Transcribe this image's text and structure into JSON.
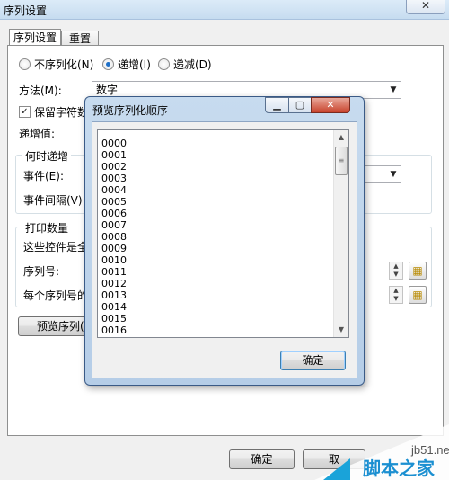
{
  "window": {
    "title": "序列设置",
    "close_glyph": "✕"
  },
  "tabs": [
    {
      "label": "序列设置",
      "active": true
    },
    {
      "label": "重置",
      "active": false
    }
  ],
  "order": {
    "options": [
      {
        "label": "不序列化(N)",
        "selected": false
      },
      {
        "label": "递增(I)",
        "selected": true
      },
      {
        "label": "递减(D)",
        "selected": false
      }
    ]
  },
  "method": {
    "label": "方法(M):",
    "value": "数字"
  },
  "keep_chars": {
    "label": "保留字符数",
    "checked": true
  },
  "increment": {
    "label": "递增值:"
  },
  "when_group": {
    "title": "何时递增",
    "event_label": "事件(E):",
    "interval_label": "事件间隔(V):"
  },
  "print_group": {
    "title": "打印数量",
    "note": "这些控件是全",
    "serial_label": "序列号:",
    "per_serial_label": "每个序列号的"
  },
  "preview_button": "预览序列(",
  "footer": {
    "ok": "确定",
    "cancel_partial": "取"
  },
  "preview_dialog": {
    "title": "预览序列化顺序",
    "items": [
      "0000",
      "0001",
      "0002",
      "0003",
      "0004",
      "0005",
      "0006",
      "0007",
      "0008",
      "0009",
      "0010",
      "0011",
      "0012",
      "0013",
      "0014",
      "0015",
      "0016"
    ],
    "ok": "确定"
  },
  "watermark": {
    "site": "jb51.net",
    "brand": "脚本之家"
  },
  "icons": {
    "minimize": "minimize-icon",
    "maximize": "maximize-icon",
    "close": "close-icon",
    "dropdown": "chevron-down-icon",
    "spin": "spin-arrows-icon",
    "picker": "field-picker-icon"
  }
}
